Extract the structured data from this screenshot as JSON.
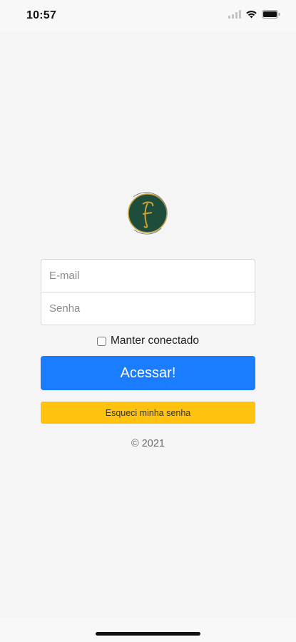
{
  "status_bar": {
    "time": "10:57",
    "icons": [
      "signal-icon",
      "wifi-icon",
      "battery-icon"
    ]
  },
  "logo": {
    "icon": "logo-icon",
    "colors": {
      "fill": "#1f4d3c",
      "ring": "#c8a23a",
      "letter": "#c8a23a"
    }
  },
  "form": {
    "email": {
      "placeholder": "E-mail",
      "value": ""
    },
    "password": {
      "placeholder": "Senha",
      "value": ""
    },
    "remember": {
      "label": "Manter conectado",
      "checked": false
    },
    "submit_label": "Acessar!",
    "forgot_label": "Esqueci minha senha"
  },
  "footer": {
    "copyright": "© 2021"
  },
  "colors": {
    "primary": "#1a7cff",
    "warning": "#ffc20e",
    "background": "#f5f5f5"
  }
}
